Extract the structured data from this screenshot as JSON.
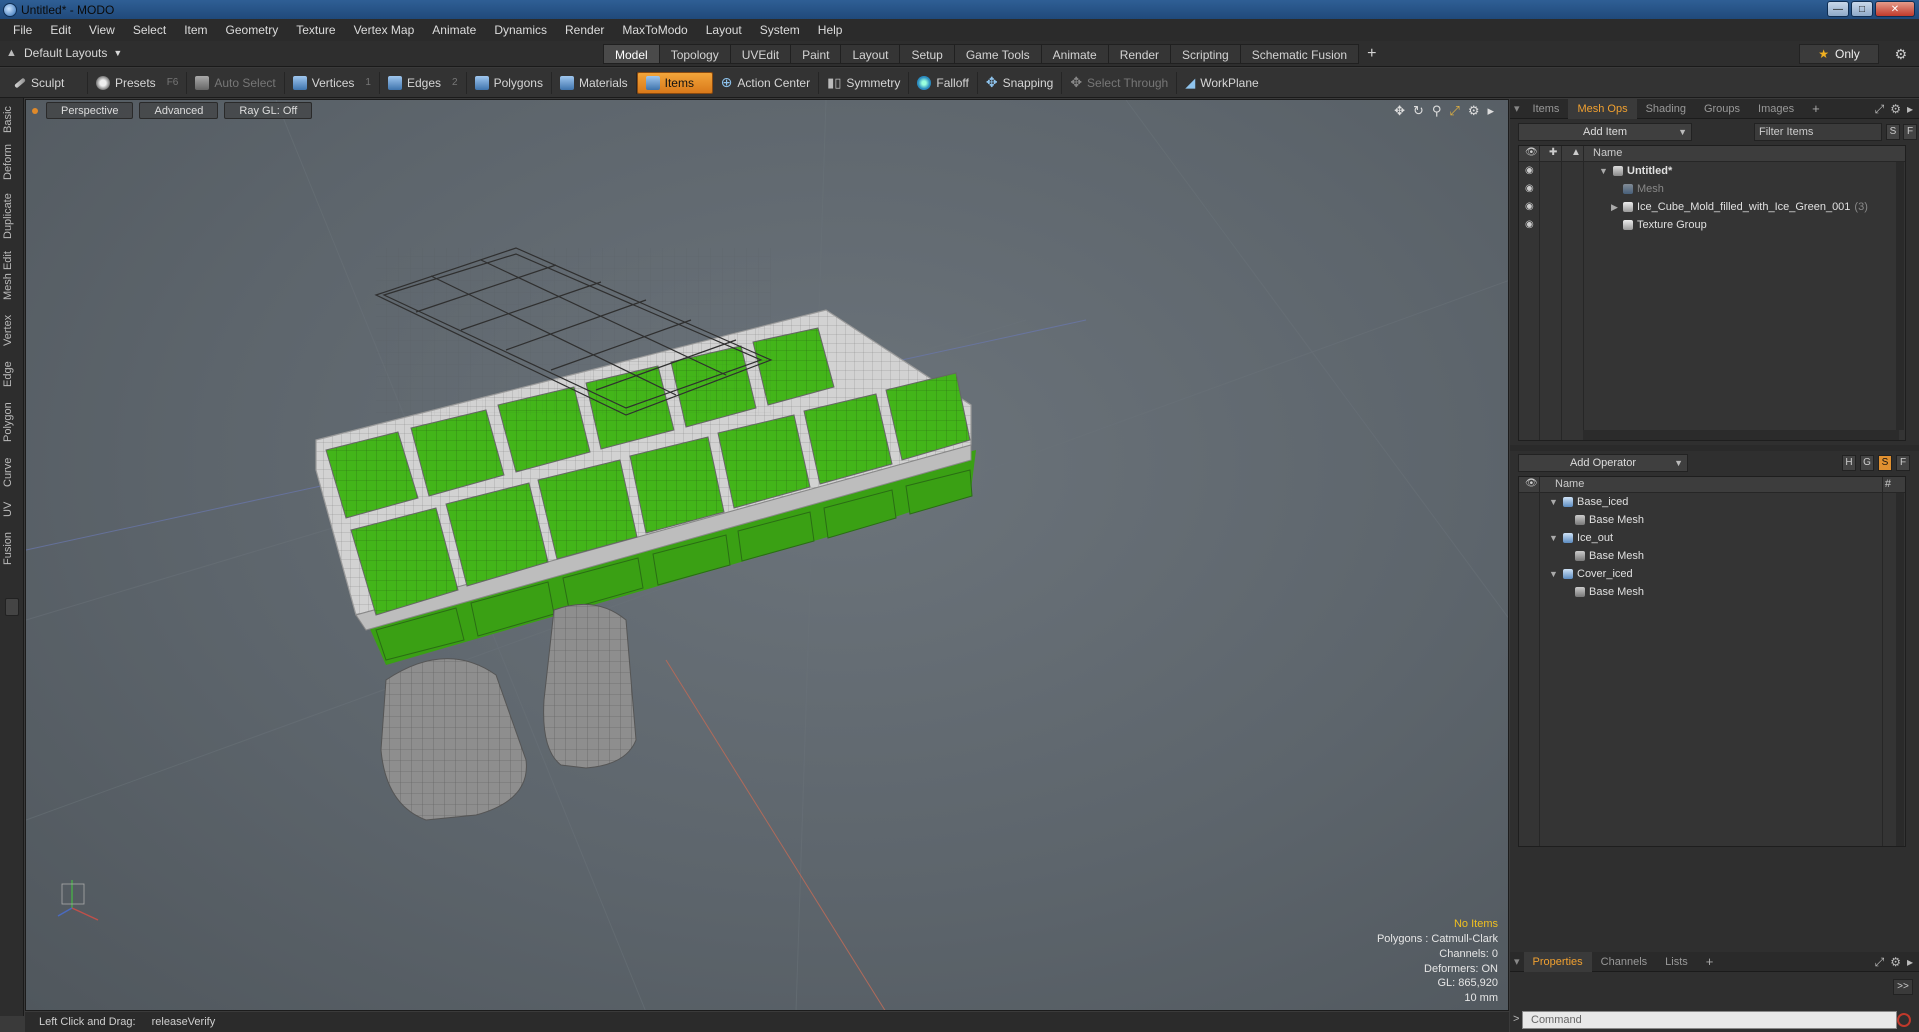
{
  "window": {
    "title": "Untitled* - MODO"
  },
  "menu": [
    "File",
    "Edit",
    "View",
    "Select",
    "Item",
    "Geometry",
    "Texture",
    "Vertex Map",
    "Animate",
    "Dynamics",
    "Render",
    "MaxToModo",
    "Layout",
    "System",
    "Help"
  ],
  "layout": {
    "selector": "Default Layouts",
    "tabs": [
      "Model",
      "Topology",
      "UVEdit",
      "Paint",
      "Layout",
      "Setup",
      "Game Tools",
      "Animate",
      "Render",
      "Scripting",
      "Schematic Fusion"
    ],
    "active_tab": "Model",
    "only_label": "Only"
  },
  "toolbar": {
    "sculpt": "Sculpt",
    "presets": "Presets",
    "presets_key": "F6",
    "auto_select": "Auto Select",
    "vertices": "Vertices",
    "vertices_key": "1",
    "edges": "Edges",
    "edges_key": "2",
    "polygons": "Polygons",
    "materials": "Materials",
    "items": "Items",
    "action_center": "Action Center",
    "symmetry": "Symmetry",
    "falloff": "Falloff",
    "snapping": "Snapping",
    "select_through": "Select Through",
    "workplane": "WorkPlane"
  },
  "left_tabs": [
    "Basic",
    "Deform",
    "Duplicate",
    "Mesh Edit",
    "Vertex",
    "Edge",
    "Polygon",
    "Curve",
    "UV",
    "Fusion"
  ],
  "viewport": {
    "view": "Perspective",
    "shading": "Advanced",
    "raygl": "Ray GL: Off",
    "stats": {
      "items": "No Items",
      "polygons": "Polygons : Catmull-Clark",
      "channels": "Channels: 0",
      "deformers": "Deformers: ON",
      "gl": "GL: 865,920",
      "unit": "10 mm"
    }
  },
  "status": {
    "hint": "Left Click and Drag:",
    "action": "releaseVerify"
  },
  "items_panel": {
    "tabs": [
      "Items",
      "Mesh Ops",
      "Shading",
      "Groups",
      "Images"
    ],
    "active_tab": "Mesh Ops",
    "add_item": "Add Item",
    "filter": "Filter Items",
    "s": "S",
    "f": "F",
    "name_header": "Name",
    "rows": [
      {
        "label": "Untitled*",
        "count": ""
      },
      {
        "label": "Mesh",
        "count": ""
      },
      {
        "label": "Ice_Cube_Mold_filled_with_Ice_Green_001",
        "count": "(3)"
      },
      {
        "label": "Texture Group",
        "count": ""
      }
    ]
  },
  "ops_panel": {
    "add_operator": "Add Operator",
    "h": "H",
    "g": "G",
    "s": "S",
    "f": "F",
    "name_header": "Name",
    "hash_header": "#",
    "rows": [
      {
        "label": "Base_iced"
      },
      {
        "label": "Base Mesh"
      },
      {
        "label": "Ice_out"
      },
      {
        "label": "Base Mesh"
      },
      {
        "label": "Cover_iced"
      },
      {
        "label": "Base Mesh"
      }
    ]
  },
  "bottom_panel": {
    "tabs": [
      "Properties",
      "Channels",
      "Lists"
    ],
    "active_tab": "Properties",
    "expand": ">>",
    "command_placeholder": "Command"
  }
}
